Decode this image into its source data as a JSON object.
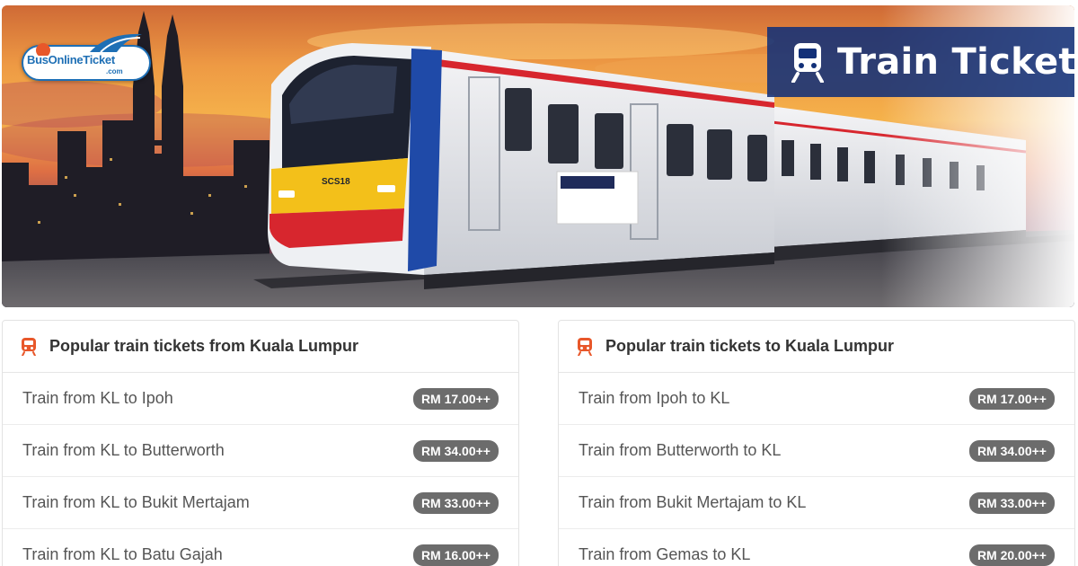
{
  "brand": {
    "logo_text": "BusOnlineTicket",
    "logo_sub": ".com",
    "primary_color": "#1e6fb5"
  },
  "hero": {
    "title": "Train Ticket",
    "title_icon": "train-icon",
    "badge_color": "#123078",
    "train_code": "SCS18"
  },
  "panels": [
    {
      "heading": "Popular train tickets from Kuala Lumpur",
      "icon": "train-icon",
      "rows": [
        {
          "route": "Train from KL to Ipoh",
          "price": "RM 17.00++"
        },
        {
          "route": "Train from KL to Butterworth",
          "price": "RM 34.00++"
        },
        {
          "route": "Train from KL to Bukit Mertajam",
          "price": "RM 33.00++"
        },
        {
          "route": "Train from KL to Batu Gajah",
          "price": "RM 16.00++"
        }
      ]
    },
    {
      "heading": "Popular train tickets to Kuala Lumpur",
      "icon": "train-icon",
      "rows": [
        {
          "route": "Train from Ipoh to KL",
          "price": "RM 17.00++"
        },
        {
          "route": "Train from Butterworth to KL",
          "price": "RM 34.00++"
        },
        {
          "route": "Train from Bukit Mertajam to KL",
          "price": "RM 33.00++"
        },
        {
          "route": "Train from Gemas to KL",
          "price": "RM 20.00++"
        }
      ]
    }
  ],
  "colors": {
    "icon_accent": "#e8572a",
    "price_badge": "#6c6c6c"
  }
}
